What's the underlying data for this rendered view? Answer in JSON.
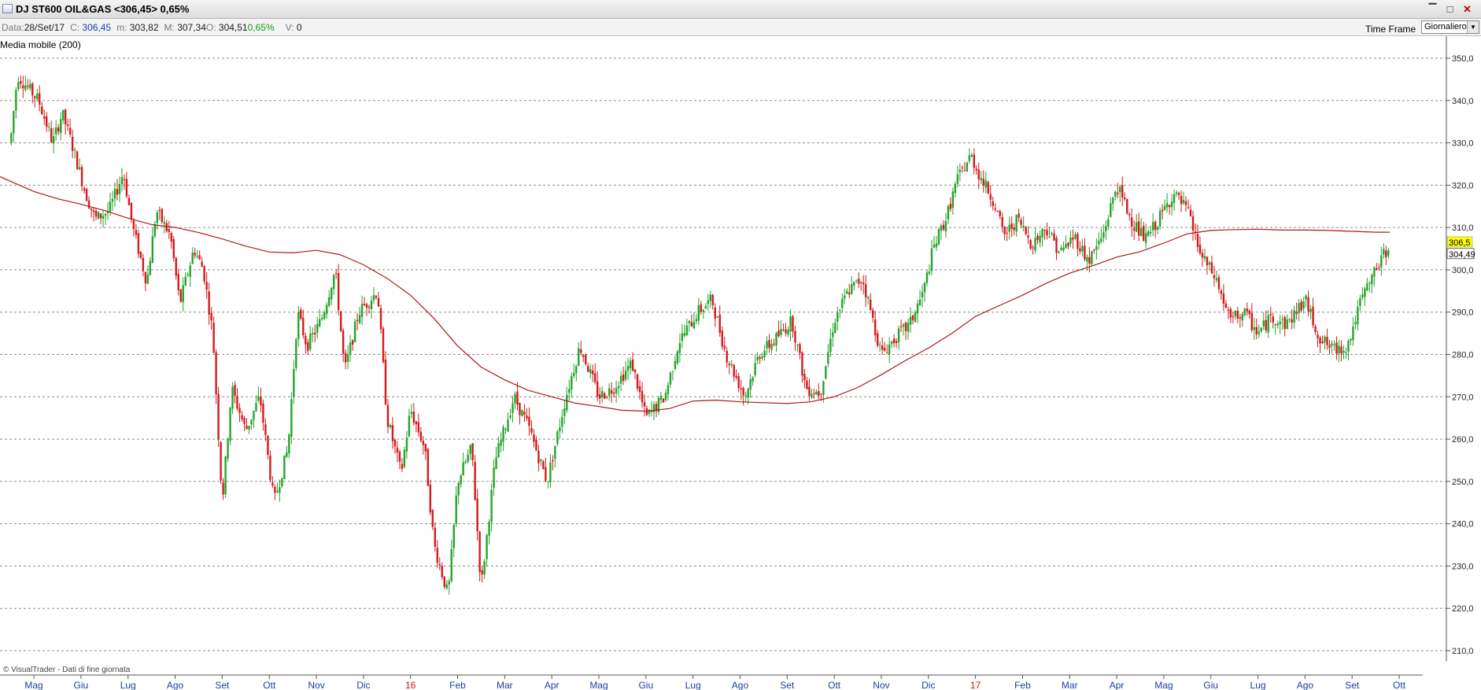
{
  "window": {
    "title": "DJ ST600 OIL&GAS <306,45> 0,65%",
    "controls": [
      "▔",
      "□",
      "✕"
    ]
  },
  "info": {
    "date_label": "Data:",
    "date": "28/Set/17",
    "close_label": "C:",
    "close": "306,45",
    "min_label": "m:",
    "min": "303,82",
    "max_label": "M:",
    "max": "307,34",
    "open_label": "O:",
    "open": "304,51",
    "pct": "0,65%",
    "vol_label": "V:",
    "vol": "0"
  },
  "timeframe": {
    "label": "Time Frame",
    "value": "Giornaliero"
  },
  "indicator_label": "Media mobile (200)",
  "copyright": "© VisualTrader - Dati di fine giornata",
  "colors": {
    "up": "#22a52a",
    "down": "#d41a1a",
    "ma": "#b01818",
    "year": "#d01010",
    "month": "#1a3f9e",
    "grid": "#8c8c8c"
  },
  "chart_data": {
    "type": "candlestick",
    "ylim": [
      205,
      354
    ],
    "y_ticks": [
      "350,0",
      "340,0",
      "330,0",
      "320,0",
      "310,0",
      "300,0",
      "290,0",
      "280,0",
      "270,0",
      "260,0",
      "250,0",
      "240,0",
      "230,0",
      "220,0",
      "210,0"
    ],
    "y_tick_values": [
      350,
      340,
      330,
      320,
      310,
      300,
      290,
      280,
      270,
      260,
      250,
      240,
      230,
      220,
      210
    ],
    "x_labels": [
      {
        "t": 0.5,
        "label": "Mag"
      },
      {
        "t": 1.5,
        "label": "Giu"
      },
      {
        "t": 2.5,
        "label": "Lug"
      },
      {
        "t": 3.5,
        "label": "Ago"
      },
      {
        "t": 4.5,
        "label": "Set"
      },
      {
        "t": 5.5,
        "label": "Ott"
      },
      {
        "t": 6.5,
        "label": "Nov"
      },
      {
        "t": 7.5,
        "label": "Dic"
      },
      {
        "t": 8.5,
        "label": "16",
        "year": true
      },
      {
        "t": 9.5,
        "label": "Feb"
      },
      {
        "t": 10.5,
        "label": "Mar"
      },
      {
        "t": 11.5,
        "label": "Apr"
      },
      {
        "t": 12.5,
        "label": "Mag"
      },
      {
        "t": 13.5,
        "label": "Giu"
      },
      {
        "t": 14.5,
        "label": "Lug"
      },
      {
        "t": 15.5,
        "label": "Ago"
      },
      {
        "t": 16.5,
        "label": "Set"
      },
      {
        "t": 17.5,
        "label": "Ott"
      },
      {
        "t": 18.5,
        "label": "Nov"
      },
      {
        "t": 19.5,
        "label": "Dic"
      },
      {
        "t": 20.5,
        "label": "17",
        "year": true
      },
      {
        "t": 21.5,
        "label": "Feb"
      },
      {
        "t": 22.5,
        "label": "Mar"
      },
      {
        "t": 23.5,
        "label": "Apr"
      },
      {
        "t": 24.5,
        "label": "Mag"
      },
      {
        "t": 25.5,
        "label": "Giu"
      },
      {
        "t": 26.5,
        "label": "Lug"
      },
      {
        "t": 27.5,
        "label": "Ago"
      },
      {
        "t": 28.5,
        "label": "Set"
      },
      {
        "t": 29.5,
        "label": "Ott"
      }
    ],
    "t_range": [
      -0.22,
      29.8
    ],
    "price_path": [
      [
        0,
        330
      ],
      [
        0.15,
        346
      ],
      [
        0.6,
        340
      ],
      [
        0.9,
        330
      ],
      [
        1.1,
        337
      ],
      [
        1.3,
        330
      ],
      [
        1.6,
        318
      ],
      [
        1.8,
        312
      ],
      [
        2.1,
        314
      ],
      [
        2.4,
        323
      ],
      [
        2.6,
        310
      ],
      [
        2.9,
        297
      ],
      [
        3.1,
        314
      ],
      [
        3.4,
        308
      ],
      [
        3.6,
        292
      ],
      [
        3.9,
        305
      ],
      [
        4.1,
        300
      ],
      [
        4.3,
        285
      ],
      [
        4.5,
        245
      ],
      [
        4.7,
        272
      ],
      [
        5.0,
        262
      ],
      [
        5.3,
        270
      ],
      [
        5.6,
        245
      ],
      [
        5.9,
        258
      ],
      [
        6.1,
        290
      ],
      [
        6.3,
        282
      ],
      [
        6.6,
        288
      ],
      [
        6.9,
        300
      ],
      [
        7.1,
        276
      ],
      [
        7.4,
        290
      ],
      [
        7.8,
        295
      ],
      [
        8.0,
        265
      ],
      [
        8.3,
        252
      ],
      [
        8.5,
        267
      ],
      [
        8.8,
        258
      ],
      [
        9.0,
        235
      ],
      [
        9.3,
        223
      ],
      [
        9.5,
        250
      ],
      [
        9.8,
        258
      ],
      [
        10.0,
        225
      ],
      [
        10.3,
        255
      ],
      [
        10.7,
        270
      ],
      [
        11.0,
        263
      ],
      [
        11.4,
        250
      ],
      [
        11.8,
        270
      ],
      [
        12.1,
        282
      ],
      [
        12.5,
        270
      ],
      [
        12.8,
        272
      ],
      [
        13.2,
        278
      ],
      [
        13.5,
        265
      ],
      [
        13.9,
        270
      ],
      [
        14.2,
        283
      ],
      [
        14.6,
        290
      ],
      [
        14.9,
        293
      ],
      [
        15.2,
        280
      ],
      [
        15.6,
        270
      ],
      [
        15.9,
        280
      ],
      [
        16.2,
        283
      ],
      [
        16.6,
        288
      ],
      [
        16.9,
        272
      ],
      [
        17.2,
        271
      ],
      [
        17.5,
        288
      ],
      [
        17.8,
        295
      ],
      [
        18.1,
        298
      ],
      [
        18.5,
        280
      ],
      [
        18.8,
        284
      ],
      [
        19.1,
        287
      ],
      [
        19.4,
        295
      ],
      [
        19.6,
        305
      ],
      [
        19.9,
        313
      ],
      [
        20.1,
        321
      ],
      [
        20.4,
        327
      ],
      [
        20.6,
        322
      ],
      [
        20.9,
        316
      ],
      [
        21.1,
        308
      ],
      [
        21.4,
        312
      ],
      [
        21.7,
        306
      ],
      [
        22.0,
        310
      ],
      [
        22.3,
        304
      ],
      [
        22.6,
        308
      ],
      [
        22.9,
        302
      ],
      [
        23.2,
        308
      ],
      [
        23.5,
        320
      ],
      [
        23.8,
        312
      ],
      [
        24.1,
        307
      ],
      [
        24.4,
        312
      ],
      [
        24.7,
        318
      ],
      [
        25.0,
        314
      ],
      [
        25.3,
        303
      ],
      [
        25.6,
        298
      ],
      [
        25.9,
        288
      ],
      [
        26.2,
        290
      ],
      [
        26.5,
        285
      ],
      [
        26.8,
        289
      ],
      [
        27.1,
        287
      ],
      [
        27.5,
        293
      ],
      [
        27.8,
        284
      ],
      [
        28.1,
        281
      ],
      [
        28.4,
        282
      ],
      [
        28.7,
        293
      ],
      [
        29.0,
        300
      ],
      [
        29.3,
        306
      ]
    ],
    "moving_average_200": [
      [
        -0.22,
        322
      ],
      [
        0.5,
        318.5
      ],
      [
        1.0,
        316.8
      ],
      [
        1.5,
        315.5
      ],
      [
        2.0,
        314
      ],
      [
        2.5,
        312.2
      ],
      [
        3.0,
        310.7
      ],
      [
        3.5,
        310
      ],
      [
        4.0,
        308.8
      ],
      [
        4.5,
        307.3
      ],
      [
        5.0,
        305.6
      ],
      [
        5.5,
        304.2
      ],
      [
        6.0,
        304
      ],
      [
        6.5,
        304.6
      ],
      [
        7.0,
        303.6
      ],
      [
        7.5,
        301.2
      ],
      [
        8.0,
        298
      ],
      [
        8.5,
        294
      ],
      [
        9.0,
        288.5
      ],
      [
        9.5,
        282
      ],
      [
        10.0,
        277
      ],
      [
        10.5,
        274
      ],
      [
        11.0,
        271.5
      ],
      [
        11.5,
        270
      ],
      [
        12.0,
        268.5
      ],
      [
        12.5,
        267.7
      ],
      [
        13.0,
        266.8
      ],
      [
        13.5,
        266.6
      ],
      [
        14.0,
        267.2
      ],
      [
        14.5,
        269
      ],
      [
        15.0,
        269.2
      ],
      [
        15.5,
        268.8
      ],
      [
        16.0,
        268.6
      ],
      [
        16.5,
        268.4
      ],
      [
        17.0,
        268.8
      ],
      [
        17.5,
        270
      ],
      [
        18.0,
        272.2
      ],
      [
        18.5,
        275.2
      ],
      [
        19.0,
        278.5
      ],
      [
        19.5,
        281.5
      ],
      [
        20.0,
        285
      ],
      [
        20.5,
        289
      ],
      [
        21.0,
        291.5
      ],
      [
        21.5,
        294
      ],
      [
        22.0,
        296.8
      ],
      [
        22.5,
        299.2
      ],
      [
        23.0,
        301
      ],
      [
        23.5,
        303
      ],
      [
        24.0,
        304.3
      ],
      [
        24.5,
        306.3
      ],
      [
        25.0,
        308.5
      ],
      [
        25.5,
        309.3
      ],
      [
        26.0,
        309.5
      ],
      [
        26.5,
        309.6
      ],
      [
        27.0,
        309.4
      ],
      [
        27.5,
        309.4
      ],
      [
        28.0,
        309.3
      ],
      [
        28.5,
        309.1
      ],
      [
        29.0,
        308.9
      ],
      [
        29.3,
        308.9
      ]
    ],
    "last_price_label": "306,5",
    "ma_value_label": "304,49",
    "last_price_value": 306.5,
    "ma_value": 304.49
  }
}
